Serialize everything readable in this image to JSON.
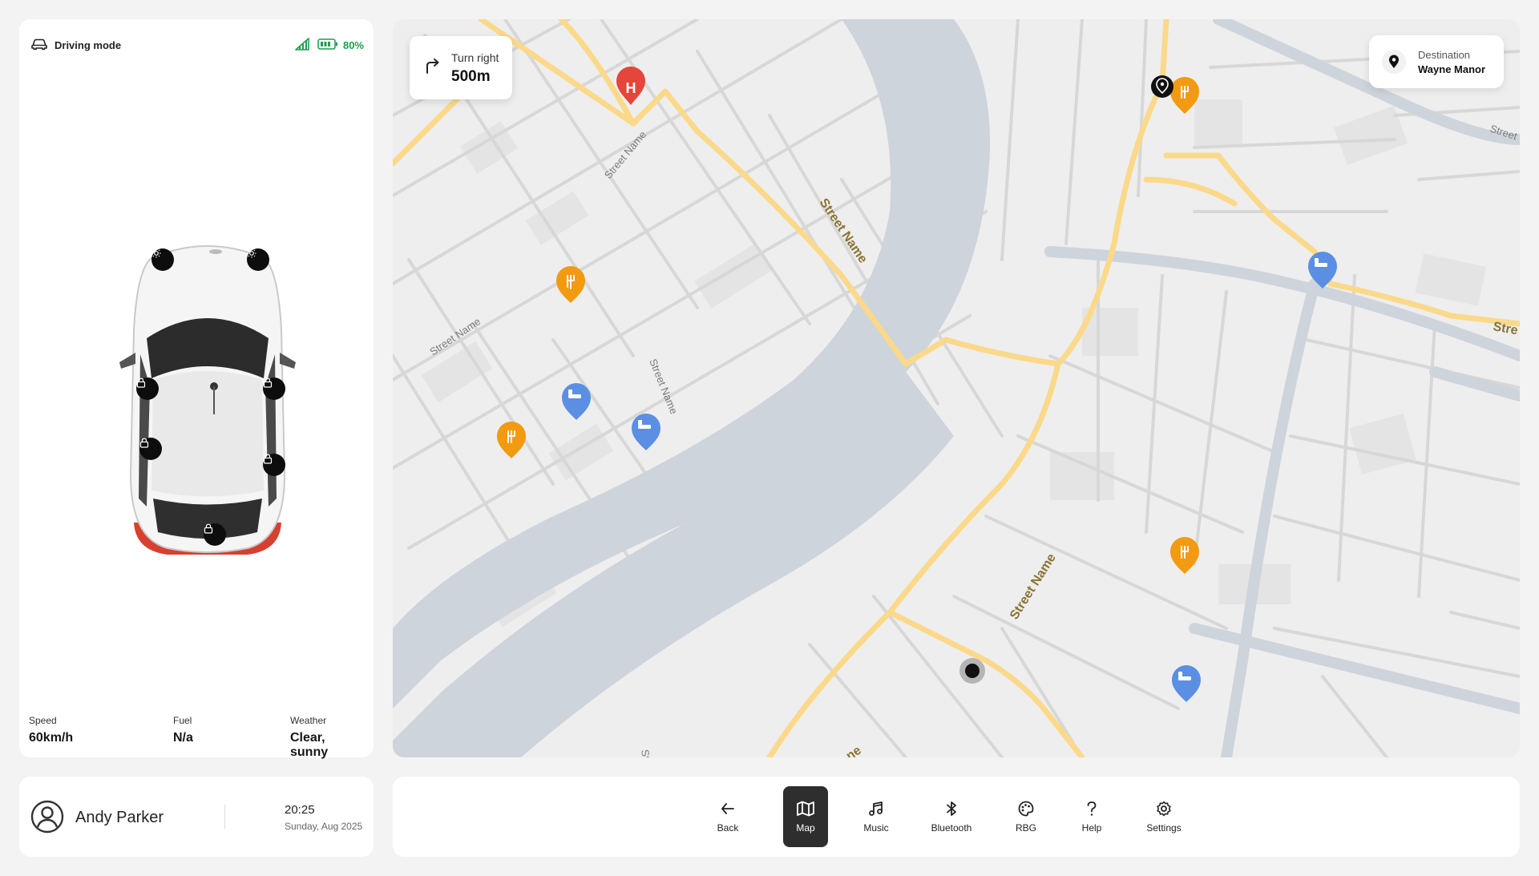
{
  "vehicle": {
    "mode_label": "Driving mode",
    "battery": "80%",
    "stats": [
      {
        "label": "Speed",
        "value": "60km/h"
      },
      {
        "label": "Fuel",
        "value": "N/a"
      },
      {
        "label": "Weather",
        "value": "Clear, sunny"
      }
    ]
  },
  "navigation": {
    "turn_instruction": "Turn right",
    "turn_distance": "500m",
    "destination_label": "Destination",
    "destination_name": "Wayne Manor",
    "street_label": "Street Name",
    "street_labels_partial": [
      "Street",
      "Stre",
      "Str",
      "ne"
    ]
  },
  "user": {
    "name": "Andy Parker",
    "time": "20:25",
    "date": "Sunday, Aug 2025"
  },
  "nav_items": [
    {
      "label": "Back",
      "icon": "back-arrow-icon",
      "active": false
    },
    {
      "label": "Map",
      "icon": "map-icon",
      "active": true
    },
    {
      "label": "Music",
      "icon": "music-icon",
      "active": false
    },
    {
      "label": "Bluetooth",
      "icon": "bluetooth-icon",
      "active": false
    },
    {
      "label": "RBG",
      "icon": "palette-icon",
      "active": false
    },
    {
      "label": "Help",
      "icon": "help-icon",
      "active": false
    },
    {
      "label": "Settings",
      "icon": "gear-icon",
      "active": false
    }
  ],
  "colors": {
    "accent_green": "#1e9e50",
    "map_water": "#cdd4db",
    "map_road_major": "#fbd98a",
    "poi_hospital": "#e5453b",
    "poi_restaurant": "#f29a12",
    "poi_hotel": "#5b8fe3"
  }
}
